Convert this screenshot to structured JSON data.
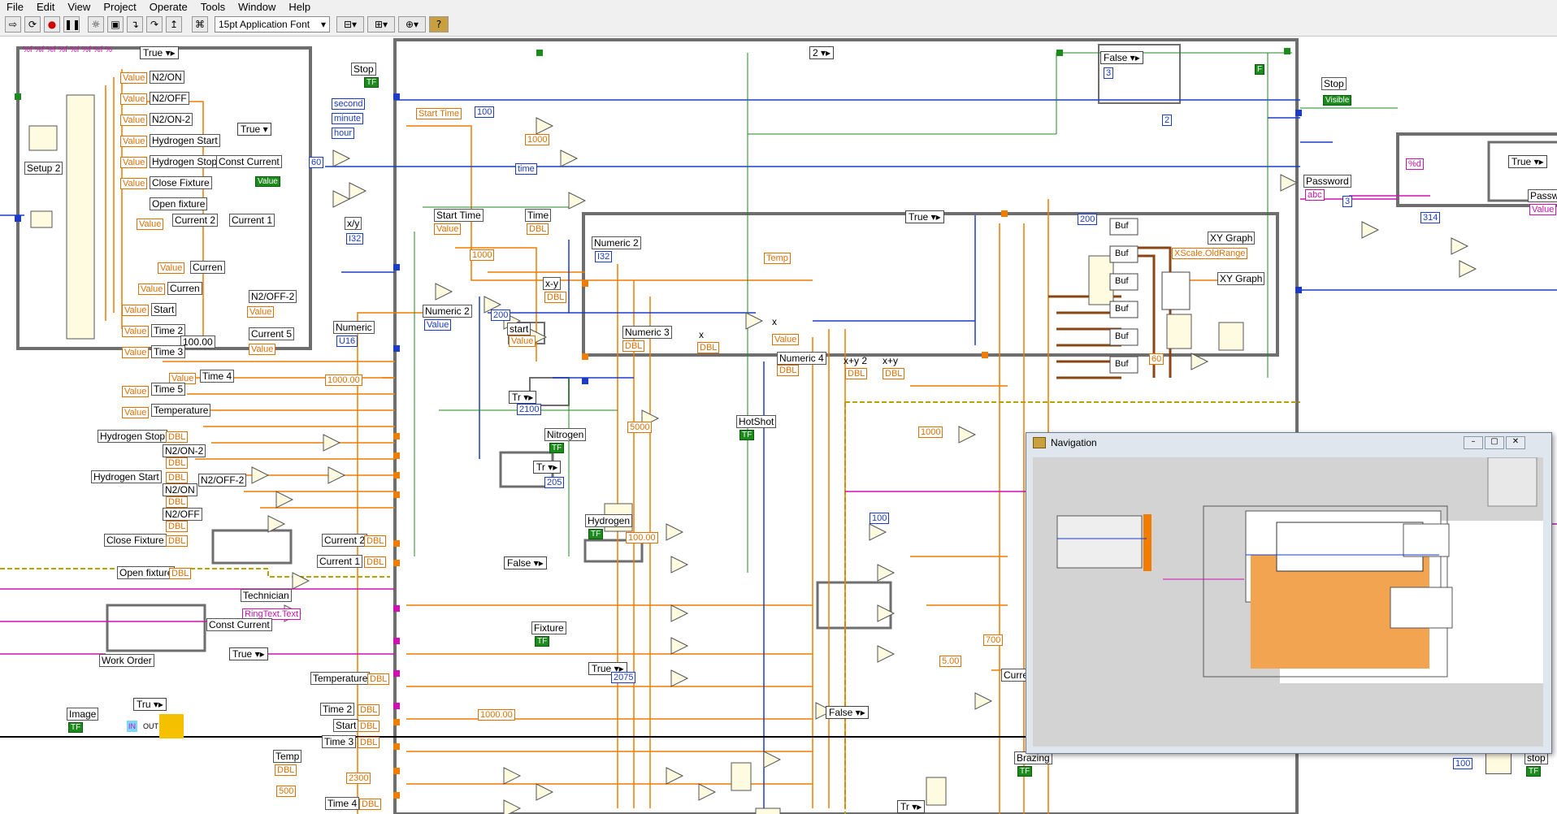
{
  "menu": [
    "File",
    "Edit",
    "View",
    "Project",
    "Operate",
    "Tools",
    "Window",
    "Help"
  ],
  "toolbar": {
    "font": "15pt Application Font"
  },
  "case_selectors": {
    "true_a": "True ▾▸",
    "true_b": "True ▾",
    "two": "2 ▾▸",
    "false_a": "False ▾▸",
    "true_c": "True ▾▸",
    "true_d": "True ▾▸",
    "true_e": "True ▾▸",
    "false_b": "False ▾▸",
    "true_f": "True ▾▸",
    "false_c": "False ▾▸",
    "true_g": "Tr ▾▸",
    "true_h": "Tru ▾▸",
    "tr1": "Tr ▾▸",
    "tr2": "Tr ▾▸"
  },
  "left_labels": {
    "n2on": "N2/ON",
    "n2off": "N2/OFF",
    "n2on2": "N2/ON-2",
    "h2start": "Hydrogen Start",
    "h2stop": "Hydrogen Stop",
    "constcur": "Const Current",
    "closefix": "Close Fixture",
    "openfix": "Open fixture",
    "cur2": "Current 2",
    "cur1": "Current 1",
    "cur": "Curren",
    "n2off2": "N2/OFF-2",
    "cur5": "Current 5",
    "start": "Start",
    "time2": "Time 2",
    "time3": "Time 3",
    "time4": "Time 4",
    "time5": "Time 5",
    "temperature": "Temperature",
    "setup2": "Setup 2",
    "value": "Value",
    "num100": "100.00",
    "fmt": "%f %f %f %f %f %f %f %"
  },
  "indicators": {
    "h2stop": "Hydrogen Stop",
    "n2on2": "N2/ON-2",
    "h2start": "Hydrogen Start",
    "n2on": "N2/ON",
    "n2off2": "N2/OFF-2",
    "n2off": "N2/OFF",
    "closefix": "Close Fixture",
    "openfix": "Open fixture",
    "cur2": "Current 2",
    "cur1": "Current 1",
    "technician": "Technician",
    "ringtext": "RingText.Text",
    "constcur": "Const Current",
    "workorder": "Work Order",
    "temperature": "Temperature",
    "image": "Image",
    "in": "IN",
    "out": "OUT",
    "time2": "Time 2",
    "start": "Start",
    "time3": "Time 3",
    "temp": "Temp",
    "time4": "Time 4",
    "dbl": "DBL",
    "tf": "TF"
  },
  "middle": {
    "stop": "Stop",
    "second": "second",
    "minute": "minute",
    "hour": "hour",
    "sixty": "60",
    "xy": "x/y",
    "i32": "I32",
    "numeric": "Numeric",
    "u16": "U16",
    "n1000_00": "1000.00",
    "starttime": "Start Time",
    "n100": "100",
    "n1000": "1000",
    "time": "time",
    "starttime2": "Start Time",
    "value": "Value",
    "time_b": "Time",
    "numeric2": "Numeric 2",
    "numeric2b": "Numeric 2",
    "n200": "200",
    "startb": "start",
    "xminusy": "x-y",
    "tr": "Tr",
    "n2100": "2100",
    "nitrogen": "Nitrogen",
    "n205": "205",
    "n5000": "5000",
    "hotshot": "HotShot",
    "hydrogen": "Hydrogen",
    "n100_00": "100.00",
    "fixture": "Fixture",
    "n2075": "2075",
    "numeric3": "Numeric 3",
    "x": "x",
    "numeric4": "Numeric 4",
    "xplusy2": "x+y 2",
    "xplusy": "x+y",
    "temp": "Temp",
    "xygraph": "XY Graph",
    "xscale": "XScale.OldRange",
    "xygraph2": "XY Graph",
    "n200b": "200",
    "n60": "60",
    "buf": "Buf",
    "three": "3",
    "two": "2",
    "f": "F",
    "n1000b": "1000",
    "n1000_00b": "1000.00",
    "n2300": "2300",
    "n500": "500",
    "n100b": "100",
    "n700": "700",
    "n5_00": "5.00",
    "curr": "Curre",
    "brazing": "Brazing"
  },
  "right": {
    "stop": "Stop",
    "visible": "Visible",
    "password": "Password",
    "abc": "abc",
    "three": "3",
    "fmt": "%d",
    "n314": "314",
    "passw": "Passw",
    "value": "Value",
    "n100": "100",
    "stop2": "stop"
  },
  "navigation": {
    "title": "Navigation"
  }
}
